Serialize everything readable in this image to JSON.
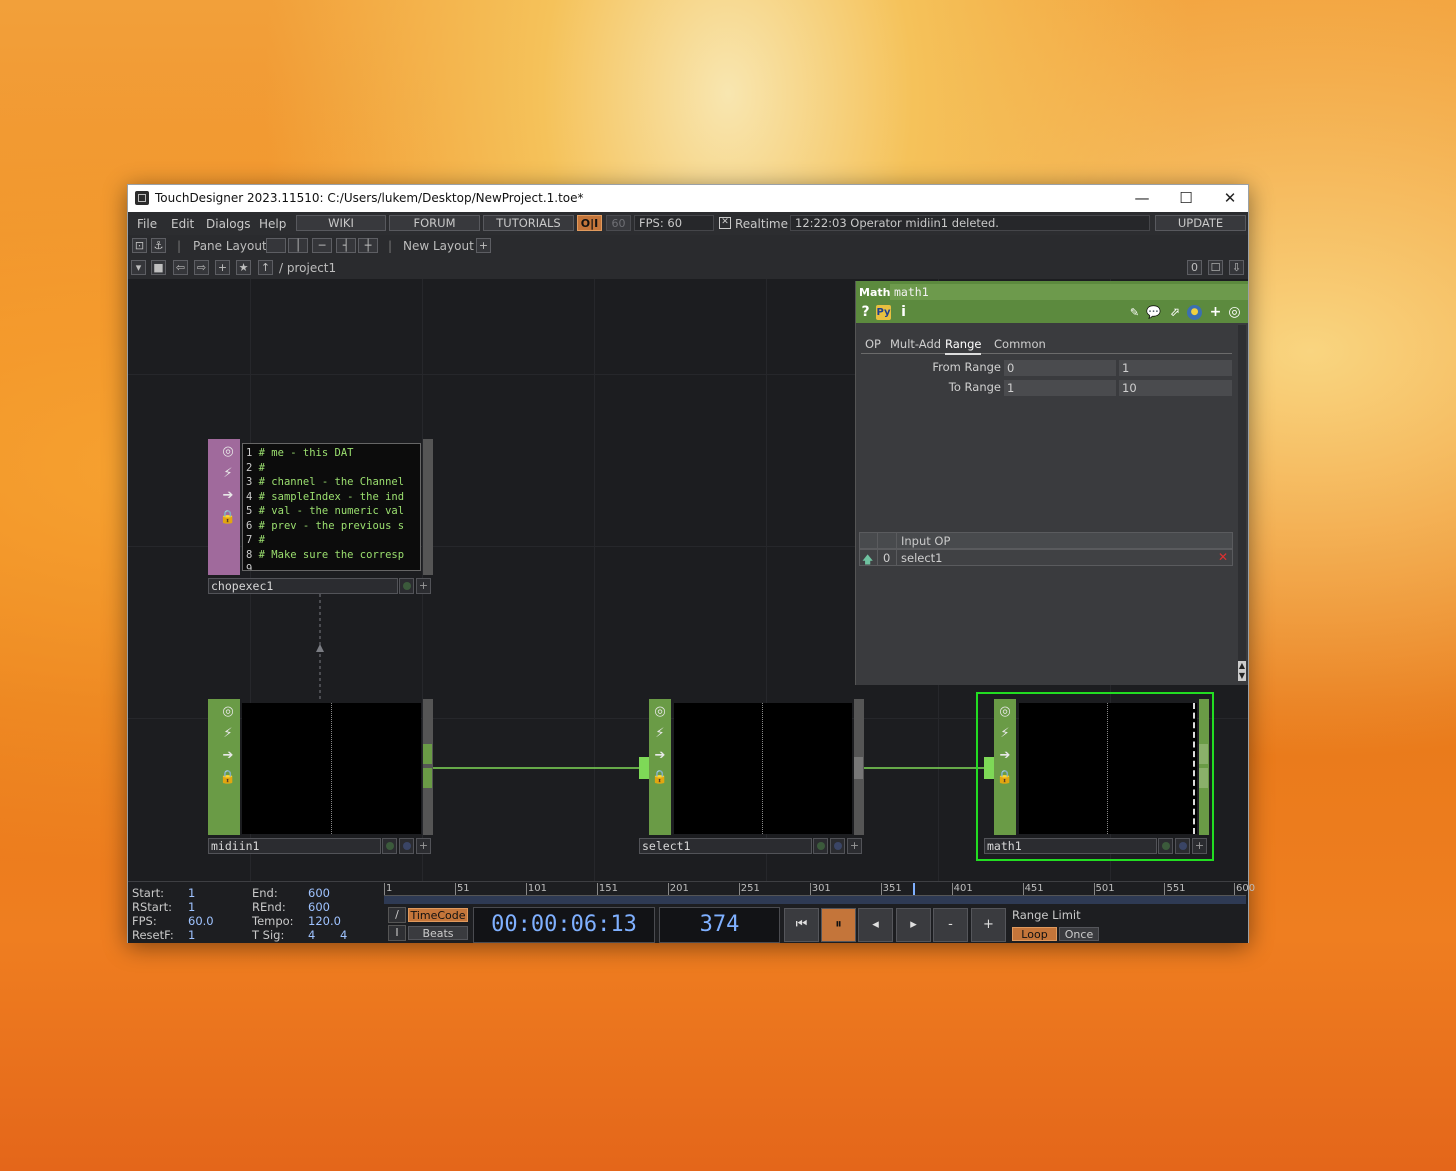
{
  "window": {
    "title": "TouchDesigner 2023.11510: C:/Users/lukem/Desktop/NewProject.1.toe*",
    "controls": {
      "minimize": "—",
      "maximize": "☐",
      "close": "✕"
    }
  },
  "menubar": {
    "menus": [
      "File",
      "Edit",
      "Dialogs",
      "Help"
    ],
    "buttons": [
      "WIKI",
      "FORUM",
      "TUTORIALS"
    ],
    "oi": "O|I",
    "fps_cap": "60",
    "fps_label": "FPS:  60",
    "realtime_check": "✕",
    "realtime_label": "Realtime",
    "status_message": "12:22:03 Operator midiin1 deleted.",
    "update_label": "UPDATE"
  },
  "toolbar": {
    "pane_layout_label": "Pane Layout",
    "new_layout_label": "New Layout",
    "path": "/ project1",
    "zero": "0"
  },
  "nodes": {
    "chopexec": {
      "name": "chopexec1",
      "code_lines": [
        {
          "n": "1",
          "text": "# me - this DAT"
        },
        {
          "n": "2",
          "text": "#"
        },
        {
          "n": "3",
          "text": "# channel - the Channel"
        },
        {
          "n": "4",
          "text": "# sampleIndex - the ind"
        },
        {
          "n": "5",
          "text": "# val - the numeric val"
        },
        {
          "n": "6",
          "text": "# prev - the previous s"
        },
        {
          "n": "7",
          "text": "#"
        },
        {
          "n": "8",
          "text": "# Make sure the corresp"
        },
        {
          "n": "9",
          "text": ""
        }
      ]
    },
    "midiin": {
      "name": "midiin1"
    },
    "select": {
      "name": "select1"
    },
    "math": {
      "name": "math1"
    }
  },
  "params": {
    "op_type": "Math",
    "op_name": "math1",
    "tabs": [
      "OP",
      "Mult-Add",
      "Range",
      "Common"
    ],
    "active_tab": "Range",
    "rows": [
      {
        "label": "From Range",
        "v1": "0",
        "v2": "1"
      },
      {
        "label": "To Range",
        "v1": "1",
        "v2": "10"
      }
    ],
    "inputs_header": "Input OP",
    "input_index": "0",
    "input_value": "select1",
    "icons": [
      "help-icon",
      "python-icon",
      "info-icon",
      "pencil-icon",
      "comment-icon",
      "clone-icon",
      "python-ball-icon",
      "plus-icon",
      "target-icon"
    ]
  },
  "timeline": {
    "labels_left": {
      "start": "Start:",
      "rstart": "RStart:",
      "fps": "FPS:",
      "resetf": "ResetF:"
    },
    "values_left": {
      "start": "1",
      "rstart": "1",
      "fps": "60.0",
      "resetf": "1"
    },
    "labels_right": {
      "end": "End:",
      "rend": "REnd:",
      "tempo": "Tempo:",
      "tsig": "T Sig:"
    },
    "values_right": {
      "end": "600",
      "rend": "600",
      "tempo": "120.0",
      "tsig_a": "4",
      "tsig_b": "4"
    },
    "ruler_ticks": [
      "1",
      "51",
      "101",
      "151",
      "201",
      "251",
      "301",
      "351",
      "401",
      "451",
      "501",
      "551",
      "600"
    ],
    "timecode_label": "TimeCode",
    "beats_label": "Beats",
    "timecode": "00:00:06:13",
    "frame": "374",
    "range_limit_label": "Range Limit",
    "loop_label": "Loop",
    "once_label": "Once",
    "slash": "/",
    "bar": "I",
    "btn_minus": "-",
    "btn_plus": "+"
  },
  "colors": {
    "chop_green": "#6a9b46",
    "dat_pink": "#a06a9c",
    "wire_green": "#7ed957",
    "selected_outline": "#22dd22",
    "accent_orange": "#c4753a",
    "timecode_blue": "#7fb0ff"
  }
}
